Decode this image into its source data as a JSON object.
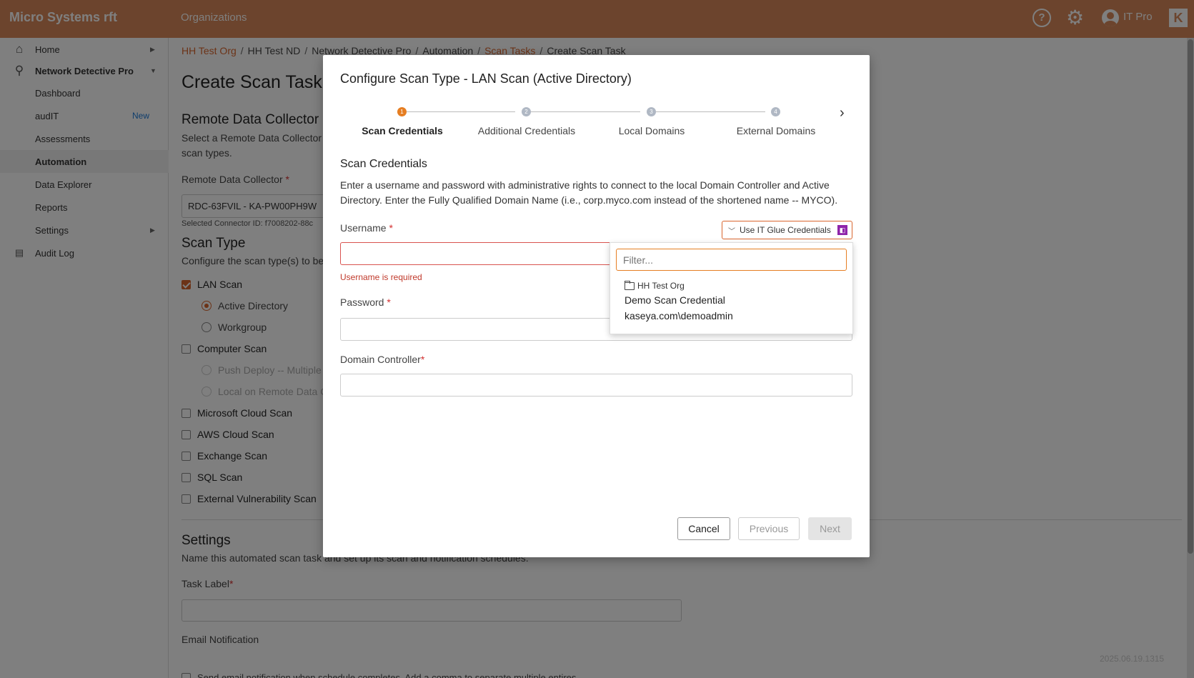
{
  "topbar": {
    "brand": "Micro Systems rft",
    "org_link": "Organizations",
    "user": "IT Pro",
    "logo": "K",
    "help_glyph": "?",
    "gear_glyph": "⚙"
  },
  "sidebar": {
    "items": [
      {
        "label": "Home",
        "icon": "home-icon",
        "glyph": "⌂"
      },
      {
        "label": "Network Detective Pro",
        "icon": "search-icon",
        "glyph": "⚲"
      },
      {
        "label": "Dashboard"
      },
      {
        "label": "audIT",
        "badge": "New"
      },
      {
        "label": "Assessments"
      },
      {
        "label": "Automation"
      },
      {
        "label": "Data Explorer"
      },
      {
        "label": "Reports"
      },
      {
        "label": "Settings"
      },
      {
        "label": "Audit Log",
        "icon": "clipboard-icon",
        "glyph": "📋"
      }
    ]
  },
  "breadcrumb": [
    "HH Test Org",
    "HH Test ND",
    "Network Detective Pro",
    "Automation",
    "Scan Tasks",
    "Create Scan Task"
  ],
  "page": {
    "title": "Create Scan Task",
    "rdc_title": "Remote Data Collector",
    "rdc_desc_1": "Select a Remote Data Collector t",
    "rdc_desc_2": "scan types.",
    "rdc_label": "Remote Data Collector",
    "rdc_value": "RDC-63FVIL - KA-PW00PH9W",
    "connector_id": "Selected Connector ID: f7008202-88c",
    "scan_type_title": "Scan Type",
    "scan_type_desc": "Configure the scan type(s) to be",
    "scan_types": {
      "lan": "LAN Scan",
      "active_directory": "Active Directory",
      "workgroup": "Workgroup",
      "computer": "Computer Scan",
      "push_deploy": "Push Deploy -- Multiple",
      "local_remote": "Local on Remote Data C",
      "ms_cloud": "Microsoft Cloud Scan",
      "aws": "AWS Cloud Scan",
      "exchange": "Exchange Scan",
      "sql": "SQL Scan",
      "ext_vuln": "External Vulnerability Scan"
    },
    "settings_title": "Settings",
    "settings_desc": "Name this automated scan task and set up its scan and notification schedules.",
    "task_label": "Task Label",
    "email_notification": "Email Notification",
    "email_desc": "Send email notification when schedule completes. Add a comma to separate multiple entires.",
    "version": "2025.06.19.1315",
    "required_mark": "*"
  },
  "modal": {
    "title": "Configure Scan Type - LAN Scan (Active Directory)",
    "steps": [
      {
        "num": "1",
        "label": "Scan Credentials"
      },
      {
        "num": "2",
        "label": "Additional Credentials"
      },
      {
        "num": "3",
        "label": "Local Domains"
      },
      {
        "num": "4",
        "label": "External Domains"
      }
    ],
    "next_step_glyph": "›",
    "section": "Scan Credentials",
    "description": "Enter a username and password with administrative rights to connect to the local Domain Controller and Active Directory. Enter the Fully Qualified Domain Name (i.e., corp.myco.com instead of the shortened name -- MYCO).",
    "username_label": "Username",
    "username_error": "Username is required",
    "password_label": "Password",
    "dc_label": "Domain Controller",
    "itglue_button": "Use IT Glue Credentials",
    "dropdown": {
      "filter_placeholder": "Filter...",
      "group": "HH Test Org",
      "items": [
        "Demo Scan Credential",
        "kaseya.com\\demoadmin"
      ]
    },
    "buttons": {
      "cancel": "Cancel",
      "previous": "Previous",
      "next": "Next"
    }
  }
}
